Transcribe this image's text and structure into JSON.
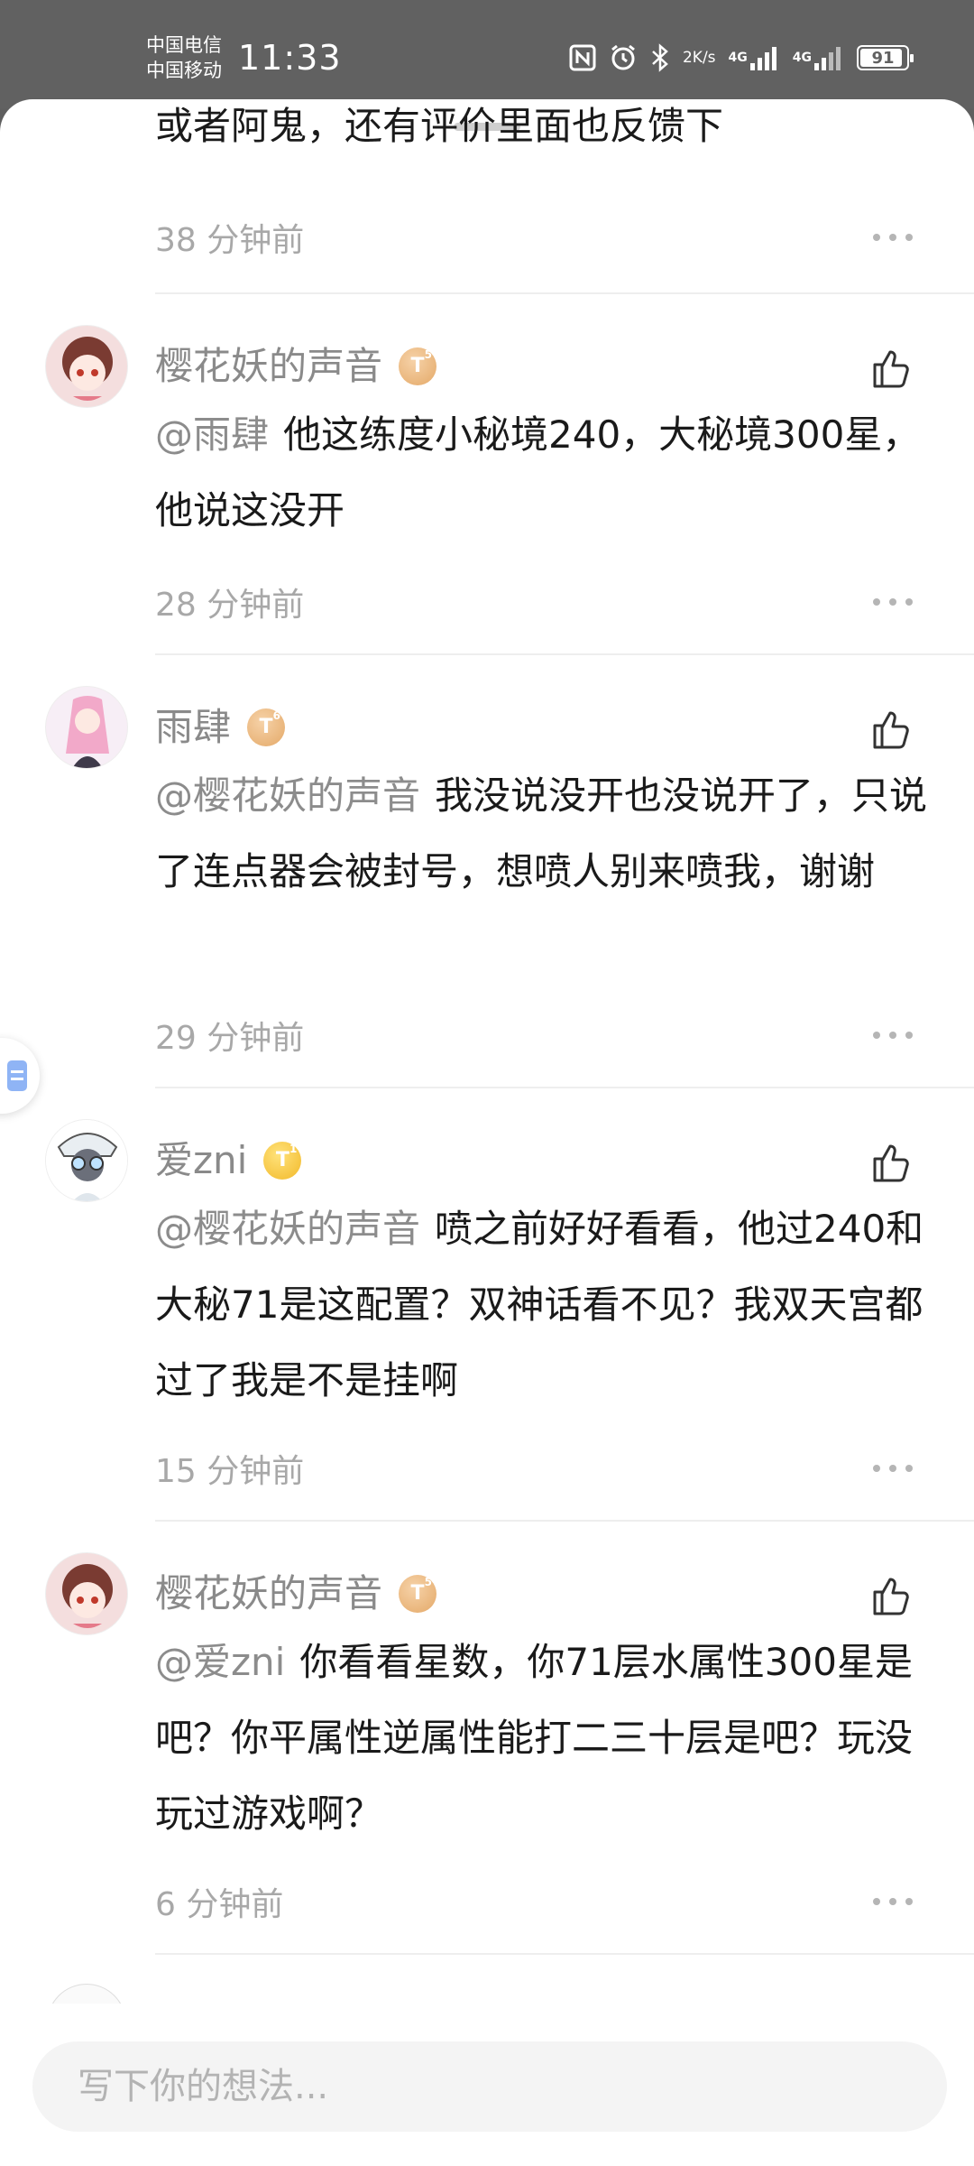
{
  "status_bar": {
    "carrier_1": "中国电信",
    "carrier_2": "中国移动",
    "time": "11:33",
    "net_speed_value": "2",
    "net_speed_unit": "K/s",
    "network_1": "4G",
    "network_2": "4G",
    "battery_level": "91",
    "icons": [
      "nfc-icon",
      "alarm-icon",
      "bluetooth-icon",
      "signal-icon",
      "battery-icon"
    ]
  },
  "partial_comment": {
    "text": "或者阿鬼，还有评价里面也反馈下",
    "time": "38 分钟前"
  },
  "comments": [
    {
      "username": "樱花妖的声音",
      "level": "T",
      "level_num": "5",
      "badge_color": "#e4a968",
      "mention": "@雨肆",
      "text": "他这练度小秘境240，大秘境300星，他说这没开",
      "time": "28 分钟前"
    },
    {
      "username": "雨肆",
      "level": "T",
      "level_num": "6",
      "badge_color": "#e4a968",
      "mention": "@樱花妖的声音",
      "text": "我没说没开也没说开了，只说了连点器会被封号，想喷人别来喷我，谢谢",
      "time": "29 分钟前"
    },
    {
      "username": "爱zni",
      "level": "T",
      "level_num": "1",
      "badge_color": "#f2b92a",
      "mention": "@樱花妖的声音",
      "text": "喷之前好好看看，他过240和大秘71是这配置？双神话看不见？我双天宫都过了我是不是挂啊",
      "time": "15 分钟前"
    },
    {
      "username": "樱花妖的声音",
      "level": "T",
      "level_num": "5",
      "badge_color": "#e4a968",
      "mention": "@爱zni",
      "text": "你看看星数，你71层水属性300星是吧？你平属性逆属性能打二三十层是吧？玩没玩过游戏啊？",
      "time": "6 分钟前"
    }
  ],
  "input": {
    "placeholder": "写下你的想法..."
  }
}
